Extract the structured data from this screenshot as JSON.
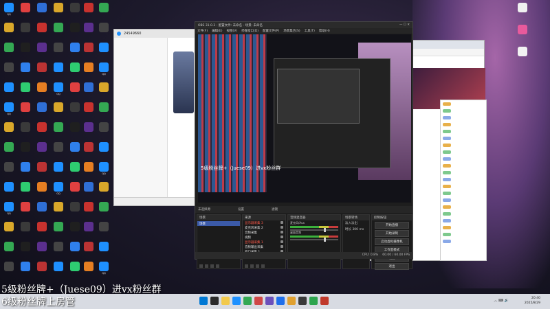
{
  "desktop": {
    "left_icons": [
      {
        "label": "QQ",
        "color": "#1e90ff"
      },
      {
        "label": "",
        "color": "#e04040"
      },
      {
        "label": "",
        "color": "#2f6fd6"
      },
      {
        "label": "",
        "color": "#d9a72a"
      },
      {
        "label": "",
        "color": "#3a3a3a"
      },
      {
        "label": "",
        "color": "#c8322e"
      },
      {
        "label": "",
        "color": "#34a853"
      },
      {
        "label": "",
        "color": "#1f1f1f"
      },
      {
        "label": "",
        "color": "#5b2f8e"
      },
      {
        "label": "",
        "color": "#444"
      },
      {
        "label": "",
        "color": "#2f80ed"
      },
      {
        "label": "",
        "color": "#b33"
      },
      {
        "label": "",
        "color": "#1e90ff"
      },
      {
        "label": "",
        "color": "#2ecc71"
      },
      {
        "label": "",
        "color": "#e67e22"
      }
    ],
    "right_icons": [
      {
        "label": "",
        "color": "#f0f0f0"
      },
      {
        "label": "",
        "color": "#e85a9c"
      },
      {
        "label": "",
        "color": "#f2f2f2"
      }
    ]
  },
  "chat_window": {
    "title_id": "24549660",
    "side_items": [
      "",
      "",
      "",
      "",
      "",
      "",
      "",
      "",
      "",
      "",
      "",
      "",
      "",
      "",
      "",
      "",
      "",
      "",
      "",
      "",
      "",
      ""
    ],
    "bottom_label": ""
  },
  "obs": {
    "title": "OBS 31.0.3 - 配置文件: 未命名 - 场景: 未命名",
    "menu": [
      "文件(F)",
      "编辑(E)",
      "视图(V)",
      "停靠窗口(D)",
      "配置文件(P)",
      "场景集合(S)",
      "工具(T)",
      "帮助(H)"
    ],
    "preview_caption": "5级粉丝牌+（Juese09）进vx粉丝群",
    "dock_head": [
      "未选择源",
      "设置",
      "滤镜"
    ],
    "scenes": {
      "title": "场景",
      "selected": "场景"
    },
    "sources": {
      "title": "来源",
      "items": [
        {
          "label": "显示器采集 3",
          "red": true
        },
        {
          "label": "麦克风采集 2",
          "red": false
        },
        {
          "label": "音频采集",
          "red": false
        },
        {
          "label": "视频",
          "red": false
        },
        {
          "label": "显示器采集 1",
          "red": true
        },
        {
          "label": "音频输出采集",
          "red": false
        },
        {
          "label": "窗口采集 1",
          "red": false
        }
      ]
    },
    "mixer": {
      "title": "音频混音器",
      "tracks": [
        "麦克风/Aux",
        "桌面音频"
      ]
    },
    "transitions": {
      "title": "场景转场",
      "type": "淡入淡出",
      "duration_label": "时长",
      "duration": "300 ms"
    },
    "controls": {
      "title": "控制按钮",
      "buttons": [
        "开始直播",
        "开始录制",
        "启动虚拟摄像机",
        "工作室模式",
        "设置",
        "退出"
      ]
    },
    "status": {
      "cpu": "CPU: 0.8%",
      "fps": "60.00 / 60.00 FPS"
    }
  },
  "captions": {
    "line1": "5级粉丝牌+（Juese09）进vx粉丝群",
    "line2": "6级粉丝牌上房管"
  },
  "browser_right_panel": {
    "rows": [
      "",
      "",
      "",
      "",
      "",
      "",
      "",
      "",
      "",
      "",
      "",
      "",
      "",
      "",
      "",
      "",
      "",
      "",
      "",
      "",
      ""
    ]
  },
  "taskbar": {
    "time": "20:40",
    "date": "2025/8/29",
    "icon_colors": [
      "#0078d4",
      "#2b2b2b",
      "#f2c94c",
      "#1e90ff",
      "#34a853",
      "#d04848",
      "#6b4fbb",
      "#1f6feb",
      "#e0a030",
      "#3a3a3a",
      "#2da44e",
      "#c0392b"
    ]
  }
}
